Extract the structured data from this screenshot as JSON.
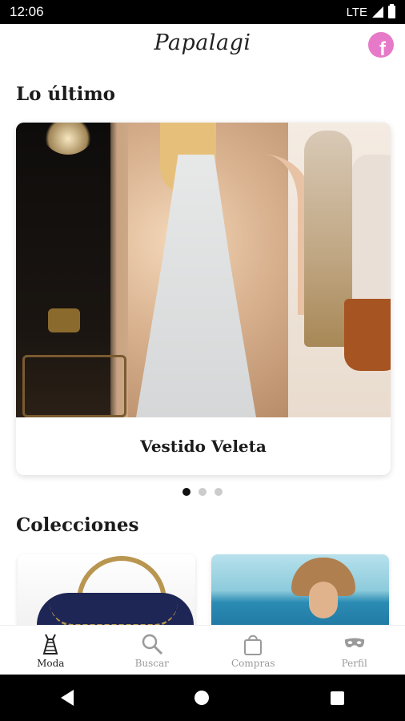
{
  "status": {
    "time": "12:06",
    "network": "LTE"
  },
  "header": {
    "logo": "Papalagi",
    "facebook_icon": "facebook-icon",
    "facebook_color": "#e77ac8"
  },
  "latest": {
    "title": "Lo último",
    "slides": [
      {
        "caption": "Vestido Veleta"
      }
    ],
    "active_dot": 0,
    "dot_count": 3
  },
  "collections": {
    "title": "Colecciones"
  },
  "bottom_nav": {
    "items": [
      {
        "label": "Moda",
        "icon": "dress-icon",
        "active": true
      },
      {
        "label": "Buscar",
        "icon": "search-icon",
        "active": false
      },
      {
        "label": "Compras",
        "icon": "shopping-bag-icon",
        "active": false
      },
      {
        "label": "Perfil",
        "icon": "mask-icon",
        "active": false
      }
    ]
  }
}
